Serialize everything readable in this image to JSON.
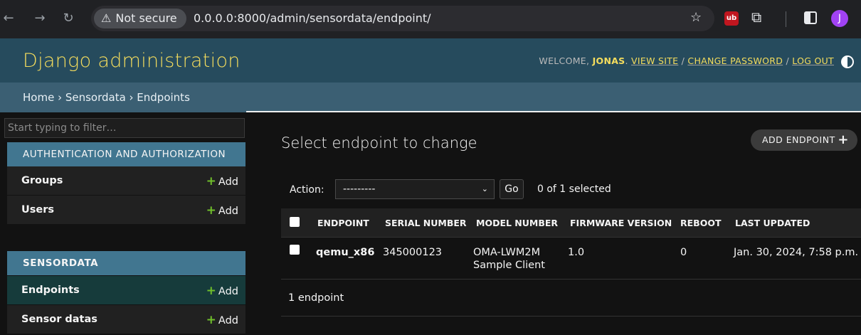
{
  "browser": {
    "security_label": "Not secure",
    "url": "0.0.0.0:8000/admin/sensordata/endpoint/",
    "avatar_letter": "J",
    "extension_ub_label": "ub",
    "icons": [
      "back-arrow-icon",
      "forward-arrow-icon",
      "reload-icon",
      "warning-icon",
      "star-icon",
      "ublock-icon",
      "puzzle-icon",
      "side-panel-icon"
    ]
  },
  "header": {
    "brand": "Django administration",
    "welcome": "WELCOME,",
    "username": "JONAS",
    "view_site": "VIEW SITE",
    "change_password": "CHANGE PASSWORD",
    "log_out": "LOG OUT",
    "separator": " / "
  },
  "breadcrumbs": {
    "text": "Home › Sensordata › Endpoints"
  },
  "sidebar": {
    "filter_placeholder": "Start typing to filter…",
    "modules": [
      {
        "caption": "AUTHENTICATION AND AUTHORIZATION",
        "models": [
          {
            "name": "Groups",
            "add": "Add"
          },
          {
            "name": "Users",
            "add": "Add"
          }
        ]
      },
      {
        "caption": "SENSORDATA",
        "models": [
          {
            "name": "Endpoints",
            "add": "Add"
          },
          {
            "name": "Sensor datas",
            "add": "Add"
          }
        ]
      }
    ]
  },
  "content": {
    "title": "Select endpoint to change",
    "add_button": "ADD ENDPOINT",
    "action_label": "Action:",
    "action_selected": "---------",
    "go_label": "Go",
    "selection_count": "0 of 1 selected",
    "columns": [
      "ENDPOINT",
      "SERIAL NUMBER",
      "MODEL NUMBER",
      "FIRMWARE VERSION",
      "REBOOT",
      "LAST UPDATED"
    ],
    "rows": [
      {
        "endpoint": "qemu_x86",
        "serial_number": "345000123",
        "model_number_line1": "OMA-LWM2M",
        "model_number_line2": "Sample Client",
        "firmware_version": "1.0",
        "reboot": "0",
        "last_updated": "Jan. 30, 2024, 7:58 p.m."
      }
    ],
    "result_count": "1 endpoint"
  },
  "colors": {
    "header_bg": "#264b5d",
    "module_caption_bg": "#417690",
    "brand_text": "#f5dd5d",
    "add_plus": "#70bf2b"
  }
}
